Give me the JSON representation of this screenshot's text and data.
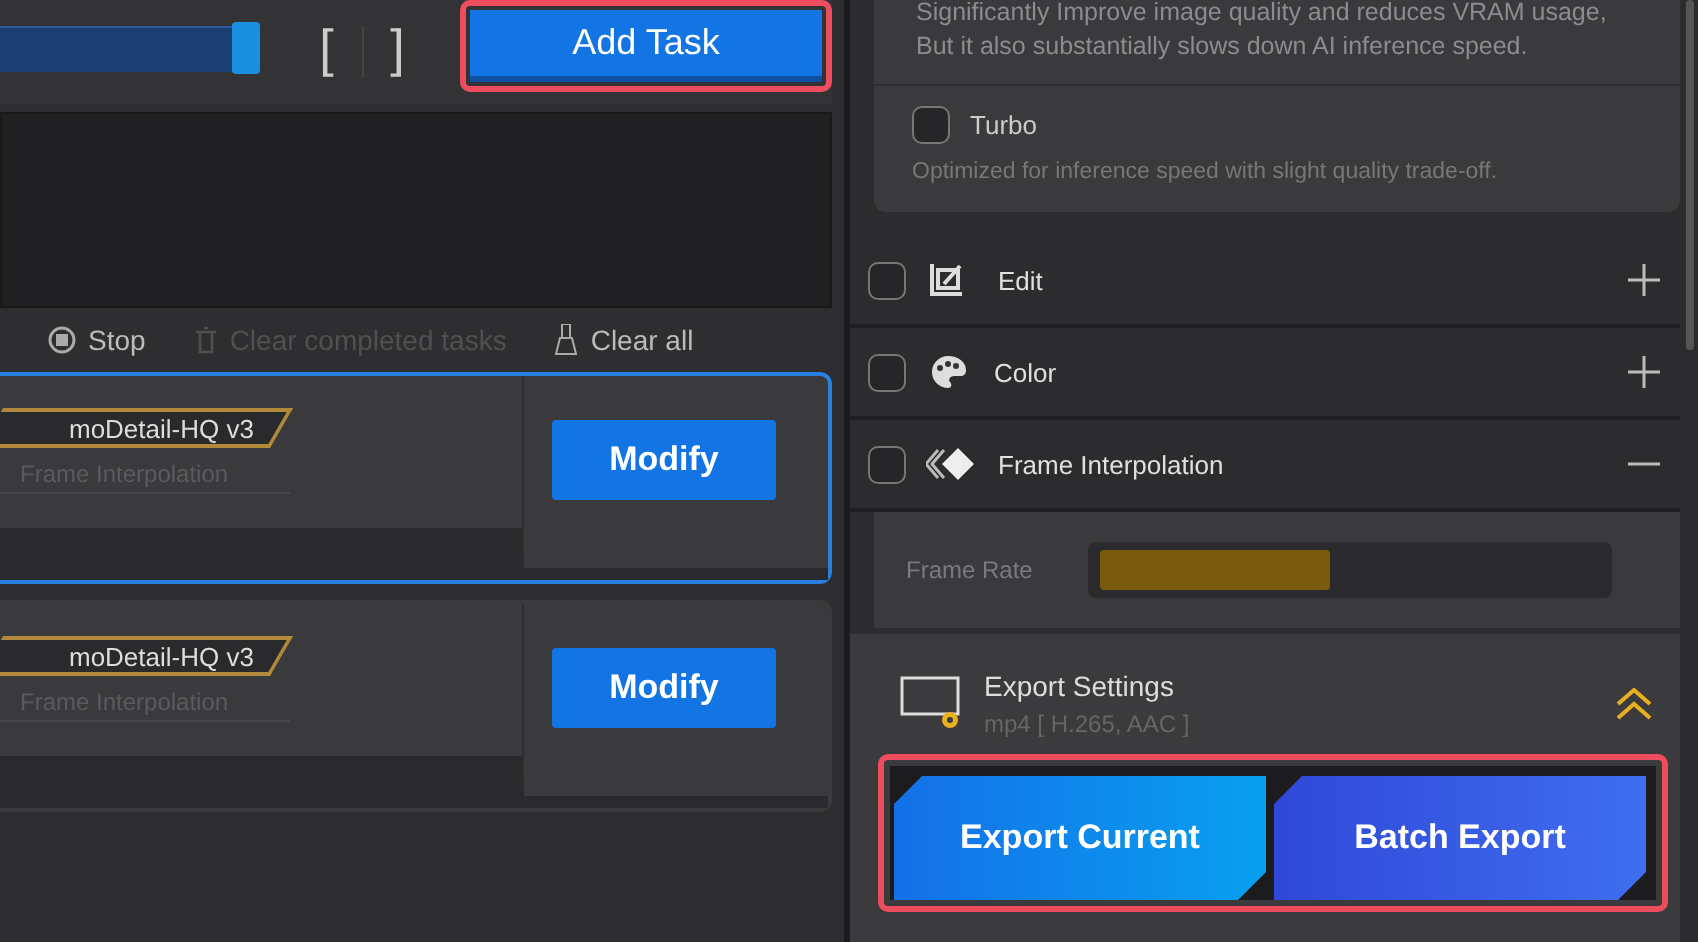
{
  "top_bar": {
    "mark_in": "[",
    "mark_out": "]",
    "add_task": {
      "label": "Add Task",
      "highlighted": true
    }
  },
  "queue_toolbar": {
    "stop": {
      "label": "Stop",
      "disabled": false
    },
    "clear_completed": {
      "label": "Clear completed tasks",
      "disabled": true
    },
    "clear_all": {
      "label": "Clear all",
      "disabled": false
    }
  },
  "tasks": [
    {
      "model": "moDetail-HQ  v3",
      "secondary": "Frame Interpolation",
      "button": "Modify",
      "selected": true
    },
    {
      "model": "moDetail-HQ  v3",
      "secondary": "Frame Interpolation",
      "button": "Modify",
      "selected": false
    }
  ],
  "options": {
    "description": "Significantly Improve image quality and reduces VRAM usage,\nBut it also substantially slows down AI inference speed.",
    "turbo": {
      "label": "Turbo",
      "checked": false,
      "note": "Optimized for inference speed with slight quality trade-off."
    }
  },
  "modules": [
    {
      "kind": "edit",
      "label": "Edit",
      "checked": false,
      "expanded": false
    },
    {
      "kind": "color",
      "label": "Color",
      "checked": false,
      "expanded": false
    },
    {
      "kind": "interpolation",
      "label": "Frame Interpolation",
      "checked": false,
      "expanded": true
    }
  ],
  "frame_rate": {
    "label": "Frame Rate",
    "level": 0.46
  },
  "export": {
    "title": "Export Settings",
    "format": "mp4 [ H.265, AAC ]",
    "highlighted": true,
    "buttons": [
      {
        "kind": "current",
        "label": "Export Current"
      },
      {
        "kind": "batch",
        "label": "Batch Export"
      }
    ]
  }
}
